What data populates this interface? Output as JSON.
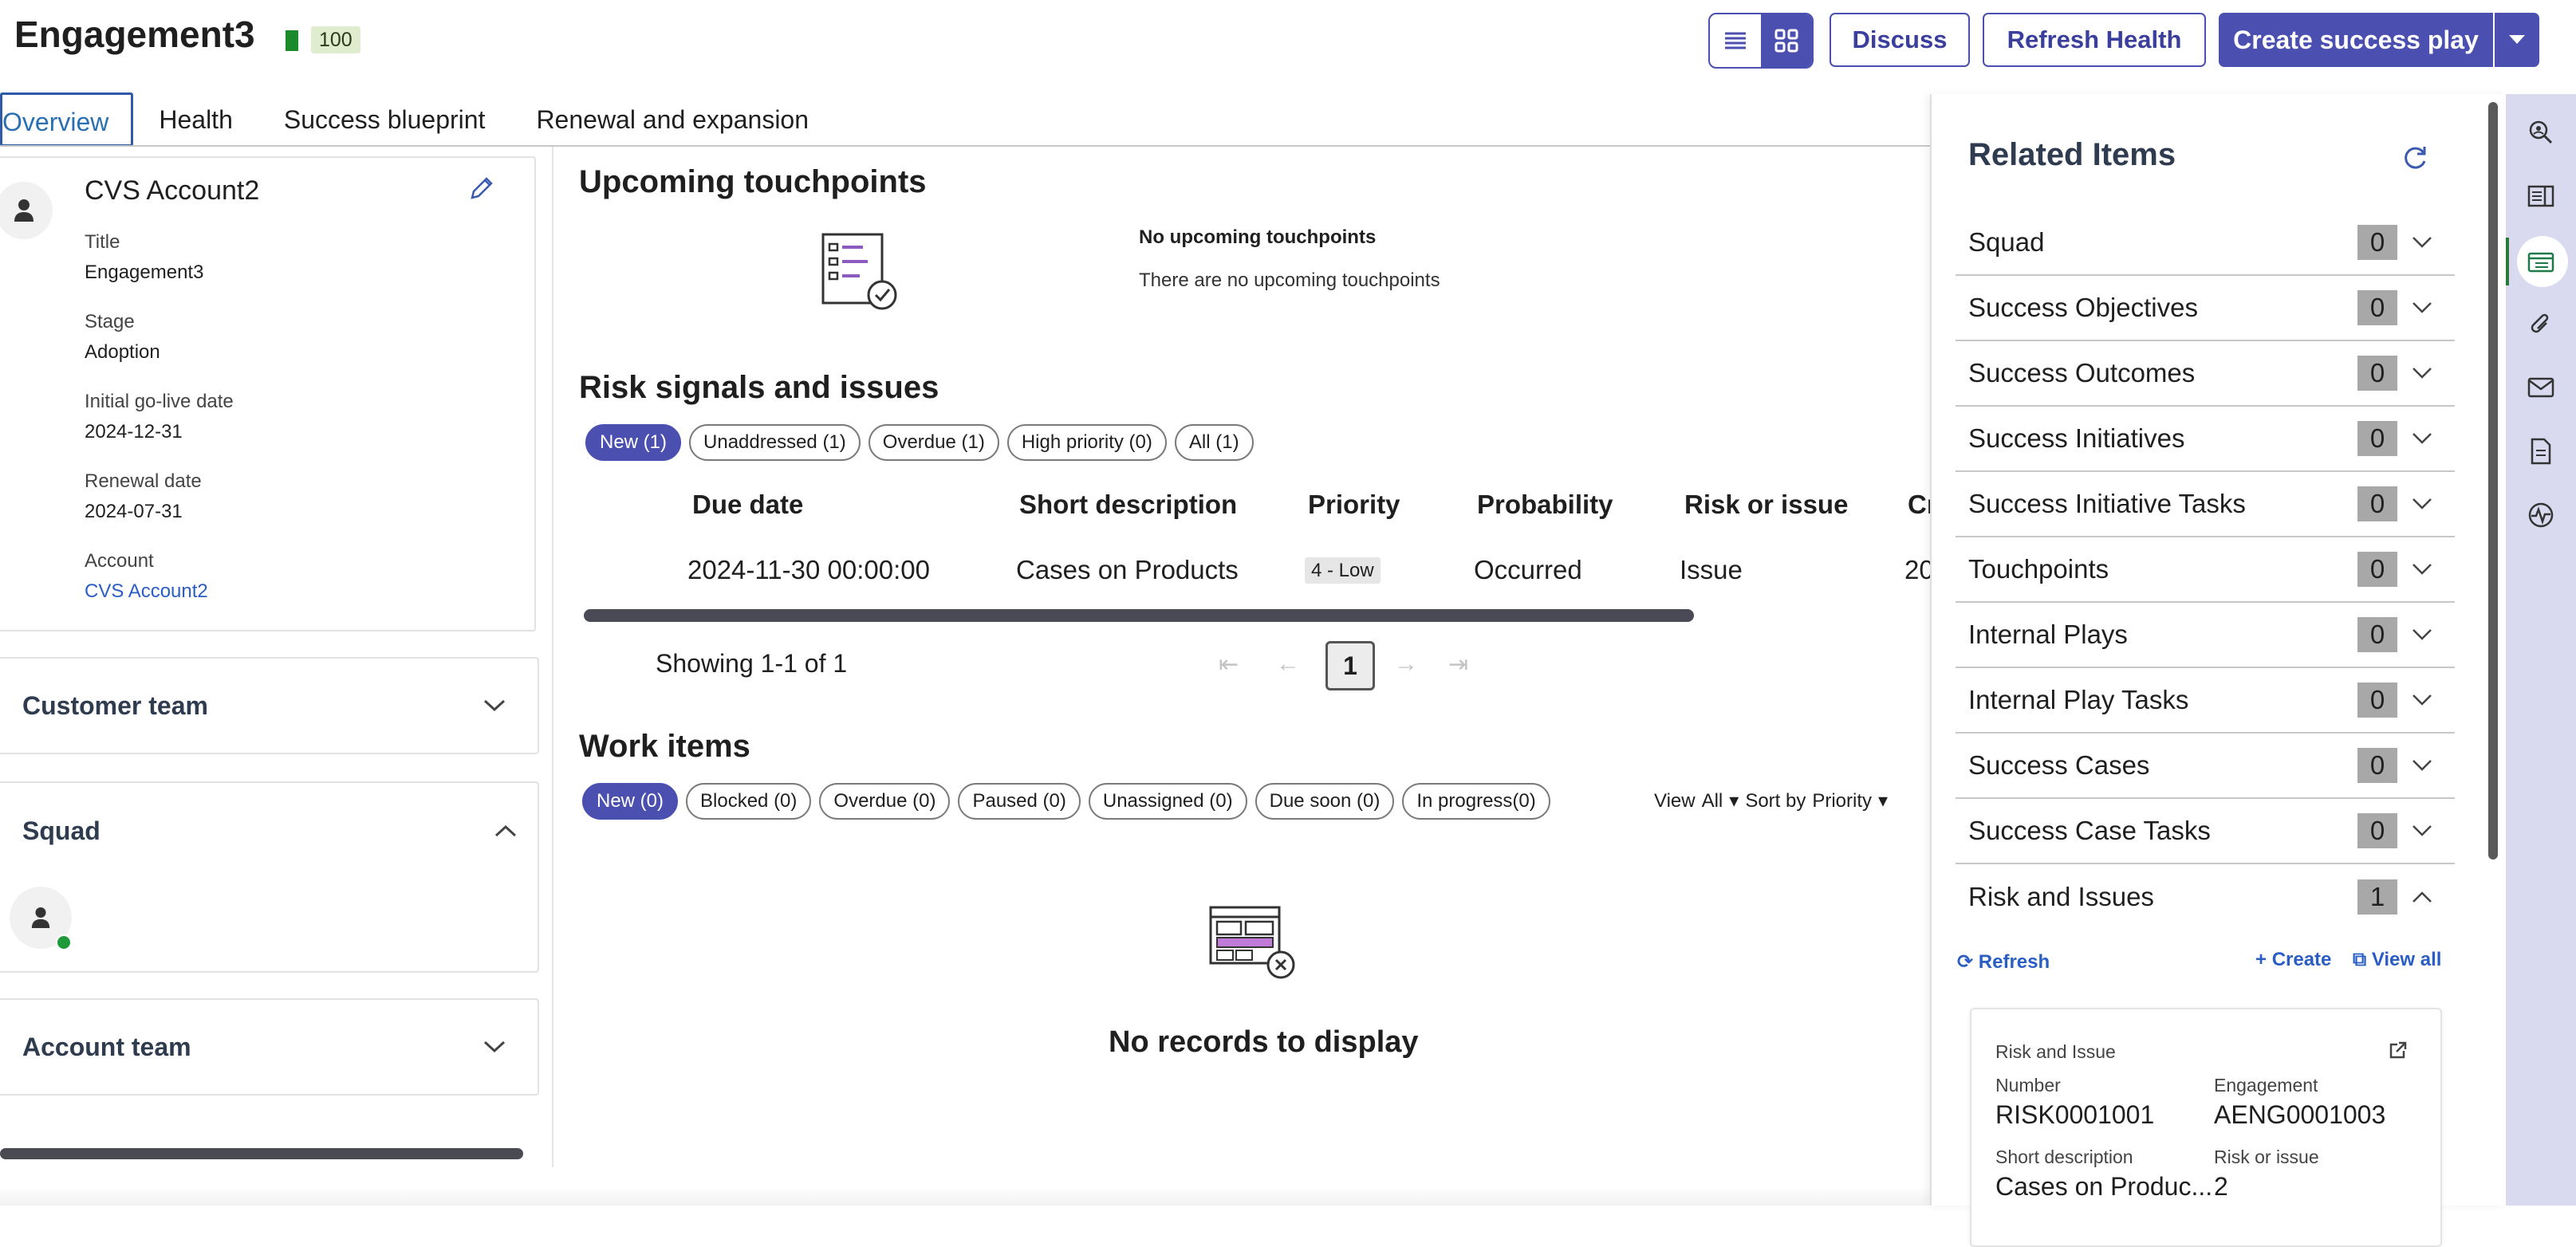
{
  "header": {
    "title": "Engagement3",
    "health_score": "100",
    "discuss_label": "Discuss",
    "refresh_health_label": "Refresh Health",
    "create_play_label": "Create success play"
  },
  "tabs": [
    "Overview",
    "Health",
    "Success blueprint",
    "Renewal and expansion"
  ],
  "account_card": {
    "name": "CVS Account2",
    "fields": [
      {
        "label": "Title",
        "value": "Engagement3"
      },
      {
        "label": "Stage",
        "value": "Adoption"
      },
      {
        "label": "Initial go-live date",
        "value": "2024-12-31"
      },
      {
        "label": "Renewal date",
        "value": "2024-07-31"
      },
      {
        "label": "Account",
        "value": "CVS Account2"
      }
    ]
  },
  "left_sections": {
    "customer_team": "Customer team",
    "squad": "Squad",
    "account_team": "Account team"
  },
  "touchpoints": {
    "heading": "Upcoming touchpoints",
    "empty_title": "No upcoming touchpoints",
    "empty_text": "There are no upcoming touchpoints"
  },
  "risks": {
    "heading": "Risk signals and issues",
    "filters": [
      "New (1)",
      "Unaddressed (1)",
      "Overdue (1)",
      "High priority (0)",
      "All (1)"
    ],
    "columns": [
      "Due date",
      "Short description",
      "Priority",
      "Probability",
      "Risk or issue",
      "Cr"
    ],
    "rows": [
      {
        "due": "2024-11-30 00:00:00",
        "desc": "Cases on Products",
        "priority": "4 - Low",
        "probability": "Occurred",
        "type": "Issue",
        "cr": "20"
      }
    ],
    "showing": "Showing 1-1 of 1",
    "page": "1"
  },
  "work_items": {
    "heading": "Work items",
    "filters": [
      "New (0)",
      "Blocked (0)",
      "Overdue (0)",
      "Paused (0)",
      "Unassigned (0)",
      "Due soon (0)",
      "In progress(0)"
    ],
    "view_label": "View",
    "view_value": "All",
    "sort_label": "Sort by",
    "sort_value": "Priority",
    "empty_text": "No records to display"
  },
  "related": {
    "title": "Related Items",
    "items": [
      {
        "name": "Squad",
        "count": "0"
      },
      {
        "name": "Success Objectives",
        "count": "0"
      },
      {
        "name": "Success Outcomes",
        "count": "0"
      },
      {
        "name": "Success Initiatives",
        "count": "0"
      },
      {
        "name": "Success Initiative Tasks",
        "count": "0"
      },
      {
        "name": "Touchpoints",
        "count": "0"
      },
      {
        "name": "Internal Plays",
        "count": "0"
      },
      {
        "name": "Internal Play Tasks",
        "count": "0"
      },
      {
        "name": "Success Cases",
        "count": "0"
      },
      {
        "name": "Success Case Tasks",
        "count": "0"
      },
      {
        "name": "Risk and Issues",
        "count": "1"
      }
    ],
    "refresh_label": "Refresh",
    "create_label": "Create",
    "view_all_label": "View all",
    "risk_card": {
      "type": "Risk and Issue",
      "number_label": "Number",
      "number": "RISK0001001",
      "engagement_label": "Engagement",
      "engagement": "AENG0001003",
      "desc_label": "Short description",
      "desc": "Cases on Produc...",
      "risk_label": "Risk or issue",
      "risk": "2"
    }
  },
  "colors": {
    "accent": "#4a4fb0",
    "link": "#2a5ec4",
    "health": "#1a8a2a"
  }
}
